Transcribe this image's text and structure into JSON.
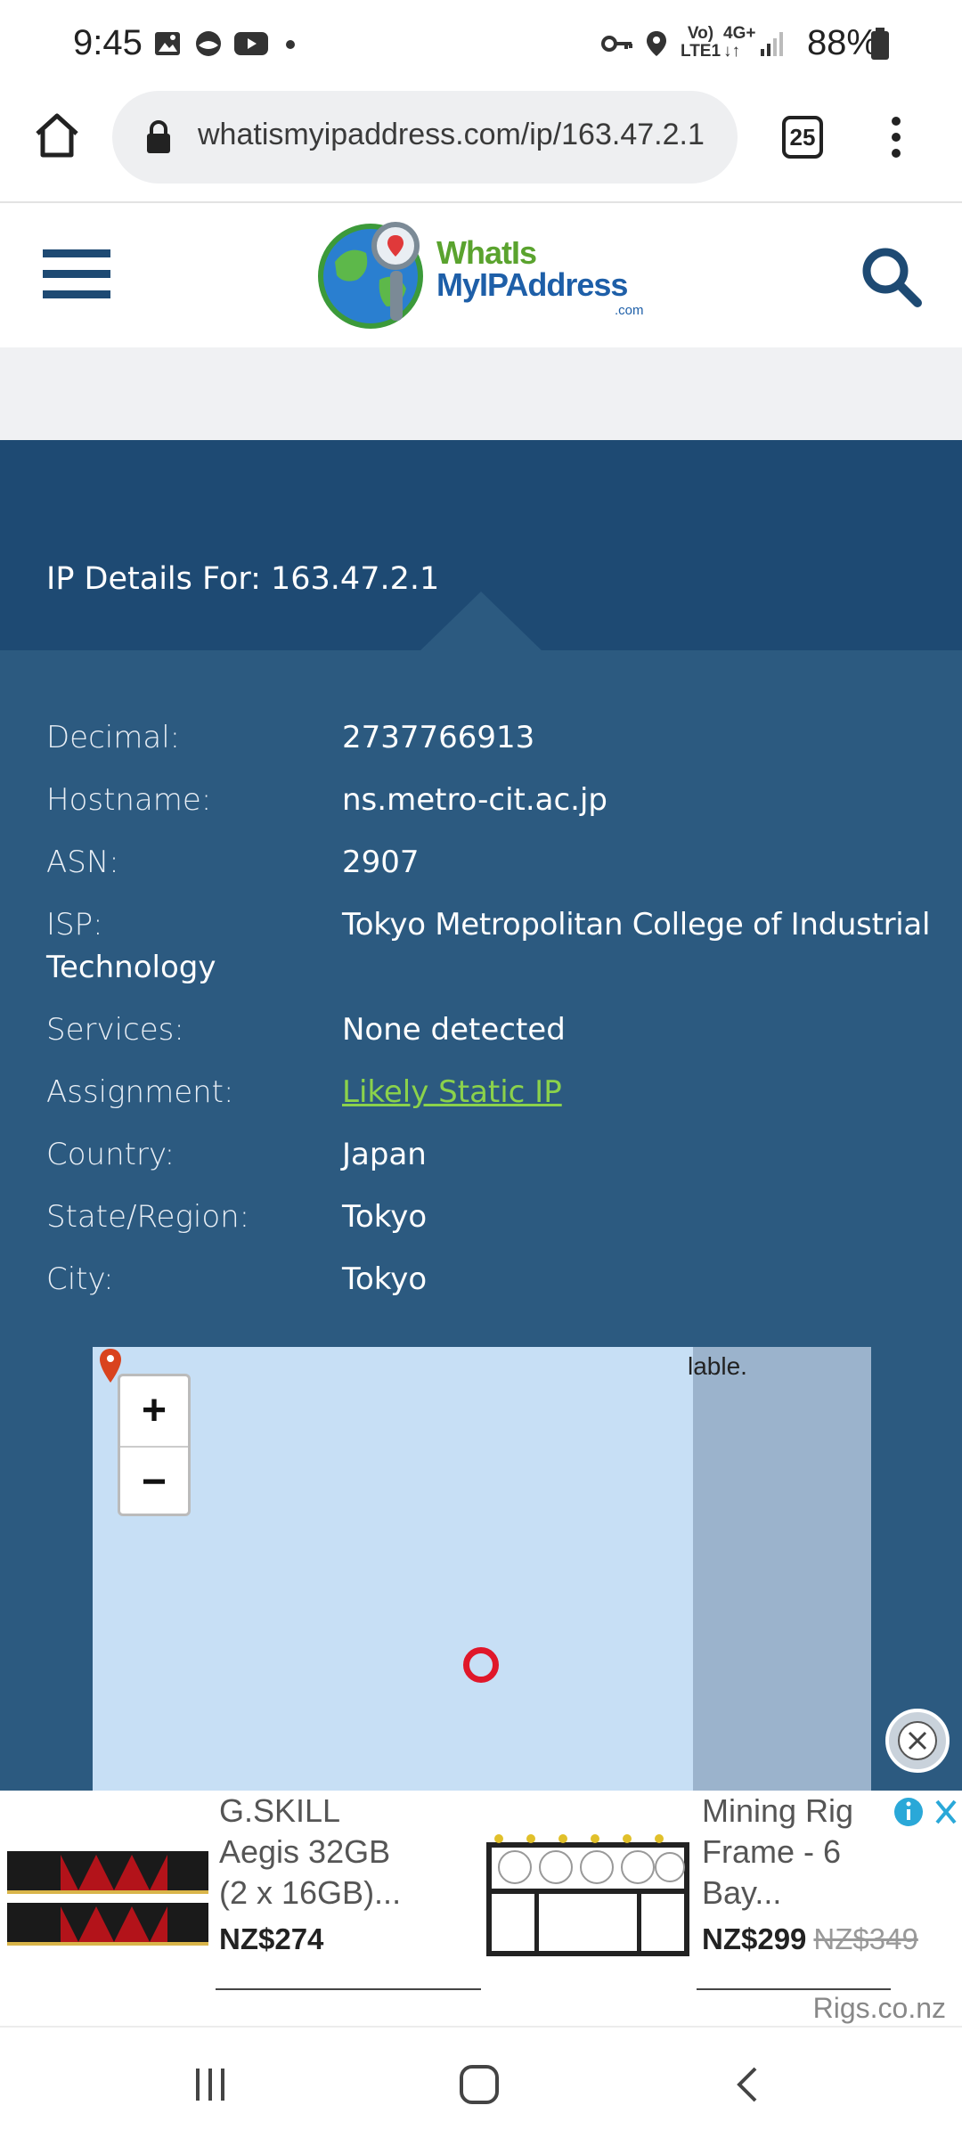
{
  "status_bar": {
    "time": "9:45",
    "battery": "88%",
    "network_top": "Vo)",
    "network_bottom": "LTE1",
    "network_type": "4G+"
  },
  "browser": {
    "url": "whatismyipaddress.com/ip/163.47.2.1",
    "tab_count": "25"
  },
  "site": {
    "logo_line1": "WhatIs",
    "logo_line2": "MyIPAddress",
    "logo_suffix": ".com"
  },
  "details": {
    "title": "IP Details For: 163.47.2.1",
    "rows": [
      {
        "label": "Decimal:",
        "value": "2737766913"
      },
      {
        "label": "Hostname:",
        "value": "ns.metro-cit.ac.jp"
      },
      {
        "label": "ASN:",
        "value": "2907"
      },
      {
        "label": "ISP:",
        "value": "Tokyo Metropolitan College of Industrial",
        "value_cont": "Technology"
      },
      {
        "label": "Services:",
        "value": "None detected"
      },
      {
        "label": "Assignment:",
        "value": "Likely Static IP"
      },
      {
        "label": "Country:",
        "value": "Japan"
      },
      {
        "label": "State/Region:",
        "value": "Tokyo"
      },
      {
        "label": "City:",
        "value": "Tokyo"
      }
    ]
  },
  "map": {
    "notice": "lable.",
    "zoom_in": "+",
    "zoom_out": "−"
  },
  "ads": {
    "items": [
      {
        "title_lines": [
          "G.SKILL",
          "Aegis 32GB",
          "(2 x 16GB)..."
        ],
        "price": "NZ$274",
        "old_price": ""
      },
      {
        "title_lines": [
          "Mining Rig",
          "Frame - 6",
          "Bay..."
        ],
        "price": "NZ$299",
        "old_price": "NZ$349"
      }
    ],
    "brand": "Rigs.co.nz"
  },
  "colors": {
    "banner": "#1e4a73",
    "panel": "#2c5a80",
    "link": "#8bd24b",
    "logo_green": "#5aa32e",
    "logo_blue": "#1e5fa8"
  }
}
